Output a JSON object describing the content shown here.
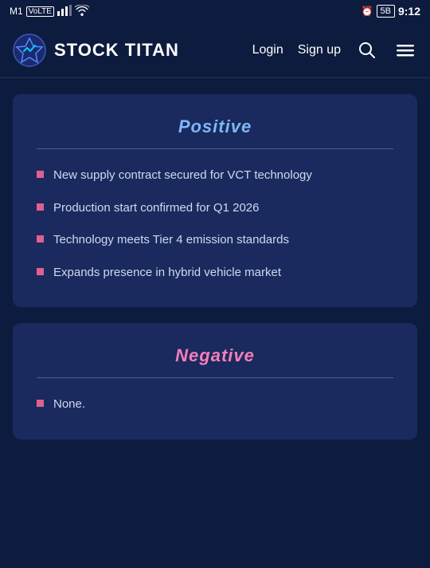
{
  "statusBar": {
    "carrier": "M1",
    "carrierBadge": "VoLTE",
    "signal": "▂▄▆",
    "wifi": "wifi",
    "alarm": "⏰",
    "battery": "5B",
    "time": "9:12"
  },
  "navbar": {
    "brandName": "STOCK TITAN",
    "loginLabel": "Login",
    "signupLabel": "Sign up"
  },
  "positiveCard": {
    "title": "Positive",
    "items": [
      "New supply contract secured for VCT technology",
      "Production start confirmed for Q1 2026",
      "Technology meets Tier 4 emission standards",
      "Expands presence in hybrid vehicle market"
    ]
  },
  "negativeCard": {
    "title": "Negative",
    "items": [
      "None."
    ]
  }
}
